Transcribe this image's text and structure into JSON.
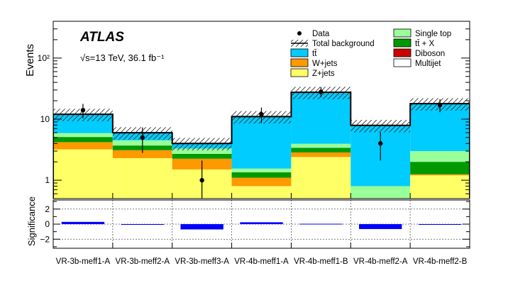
{
  "chart_data": {
    "type": "bar",
    "stacked": true,
    "log_scale_top": true,
    "ylabel": "Events",
    "ylabel_bottom": "Significance",
    "categories": [
      "VR-3b-meff1-A",
      "VR-3b-meff2-A",
      "VR-3b-meff3-A",
      "VR-4b-meff1-A",
      "VR-4b-meff1-B",
      "VR-4b-meff2-A",
      "VR-4b-meff2-B"
    ],
    "ylim": [
      0.5,
      400
    ],
    "yticks": [
      {
        "value": 1,
        "label": "1"
      },
      {
        "value": 10,
        "label": "10"
      },
      {
        "value": 100,
        "label": "10²"
      }
    ],
    "sig_ylim": [
      -3.2,
      3.2
    ],
    "sig_yticks": [
      {
        "value": 2,
        "label": "2"
      },
      {
        "value": 0,
        "label": "0"
      },
      {
        "value": -2,
        "label": "−2"
      }
    ],
    "experiment_label": "ATLAS",
    "lumi_label": "√s=13 TeV, 36.1 fb⁻¹",
    "series": [
      {
        "name": "Z+jets",
        "color": "#ffff66",
        "values": [
          3.2,
          2.3,
          1.5,
          0.8,
          2.4,
          0.5,
          1.2
        ]
      },
      {
        "name": "W+jets",
        "color": "#ff9900",
        "values": [
          1.0,
          0.8,
          0.75,
          0.3,
          0.45,
          0.0,
          0.05
        ]
      },
      {
        "name": "tt̄ + X",
        "color": "#009900",
        "values": [
          0.9,
          0.6,
          0.45,
          0.25,
          0.55,
          0.0,
          0.75
        ]
      },
      {
        "name": "Single top",
        "color": "#99ff99",
        "values": [
          0.8,
          0.8,
          0.6,
          0.2,
          0.55,
          0.3,
          1.0
        ]
      },
      {
        "name": "tt̄",
        "color": "#00ccff",
        "values": [
          6.1,
          1.5,
          0.7,
          9.45,
          23.55,
          7.2,
          15.0
        ]
      },
      {
        "name": "Diboson",
        "color": "#cc0000",
        "values": [
          0,
          0,
          0,
          0,
          0,
          0,
          0
        ]
      },
      {
        "name": "Multijet",
        "color": "#ffffff",
        "values": [
          0,
          0,
          0,
          0,
          0,
          0,
          0
        ]
      }
    ],
    "total_background": [
      12.0,
      6.0,
      4.0,
      11.0,
      27.5,
      7.9,
      17.9
    ],
    "total_band_rel": 0.23,
    "data": {
      "name": "Data",
      "values": [
        14,
        5,
        1,
        12,
        28,
        4,
        17
      ],
      "err_up": [
        3.8,
        2.3,
        1.1,
        3.5,
        5.3,
        2.1,
        4.1
      ],
      "err_down": [
        3.7,
        2.2,
        1.0,
        3.4,
        5.2,
        1.9,
        4.0
      ]
    },
    "significance": [
      0.3,
      0.0,
      -0.7,
      0.25,
      0.05,
      -0.65,
      0.0
    ],
    "legend": {
      "col1": [
        {
          "label": "Data",
          "kind": "marker"
        },
        {
          "label": "Total background",
          "kind": "hatch"
        },
        {
          "label": "tt̄",
          "kind": "box",
          "color": "#00ccff"
        },
        {
          "label": "W+jets",
          "kind": "box",
          "color": "#ff9900"
        },
        {
          "label": "Z+jets",
          "kind": "box",
          "color": "#ffff66"
        }
      ],
      "col2": [
        {
          "label": "Single top",
          "kind": "box",
          "color": "#99ff99"
        },
        {
          "label": "tt̄ + X",
          "kind": "box",
          "color": "#009900"
        },
        {
          "label": "Diboson",
          "kind": "box",
          "color": "#cc0000"
        },
        {
          "label": "Multijet",
          "kind": "box",
          "color": "#ffffff"
        }
      ]
    }
  }
}
